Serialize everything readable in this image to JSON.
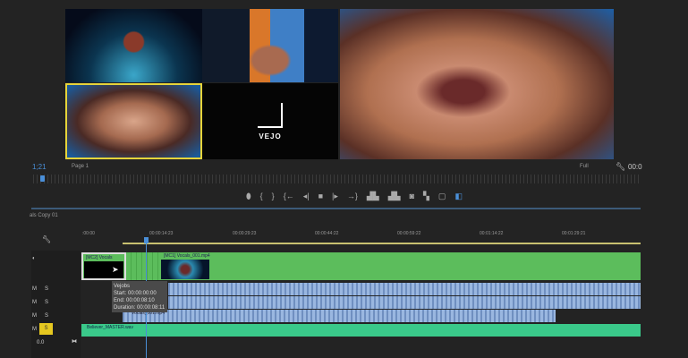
{
  "program": {
    "logo_text": "VEJO",
    "timecode": "1;21",
    "page_select": "Page 1",
    "zoom_select": "Full",
    "right_timecode": "00:0"
  },
  "transport": {
    "buttons": [
      "marker-icon",
      "mark-in-icon",
      "mark-out-icon",
      "go-to-in-icon",
      "step-back-icon",
      "stop-icon",
      "step-forward-icon",
      "go-to-out-icon",
      "lift-icon",
      "extract-icon",
      "camera-icon",
      "multicam-icon",
      "safe-margins-icon",
      "compare-icon"
    ],
    "glyphs": [
      "⬮",
      "{",
      "}",
      "{←",
      "◂|",
      "■",
      "|▸",
      "→}",
      "▟▙",
      "▟▙",
      "◙",
      "▚",
      "▢",
      "◧"
    ]
  },
  "timeline": {
    "sequence_name": "als Copy 01",
    "ruler_labels": [
      ":00:00",
      "00:00:14:23",
      "00:00:29:23",
      "00:00:44:22",
      "00:00:59:22",
      "00:01:14:22",
      "00:01:29:21"
    ],
    "clips": {
      "v1_clip1": "[MC2] Vocals",
      "v1_clip2": "[MC1] Vocals_001.mp4",
      "a3_clip": "Vocals_001.mp4",
      "a4_clip": "Believer_MASTER.wav"
    },
    "track_controls": {
      "m": "M",
      "s": "S",
      "volume": "0.0"
    },
    "tooltip": {
      "name": "Vejobs",
      "start": "Start: 00:00:00:00",
      "end": "End: 00:00:08:10",
      "duration": "Duration: 00:00:08:11"
    }
  },
  "colors": {
    "accent": "#4a8fd8",
    "video_clip": "#5cbd5c",
    "audio_clip": "#3ac98a",
    "selection": "#e6d43a"
  }
}
